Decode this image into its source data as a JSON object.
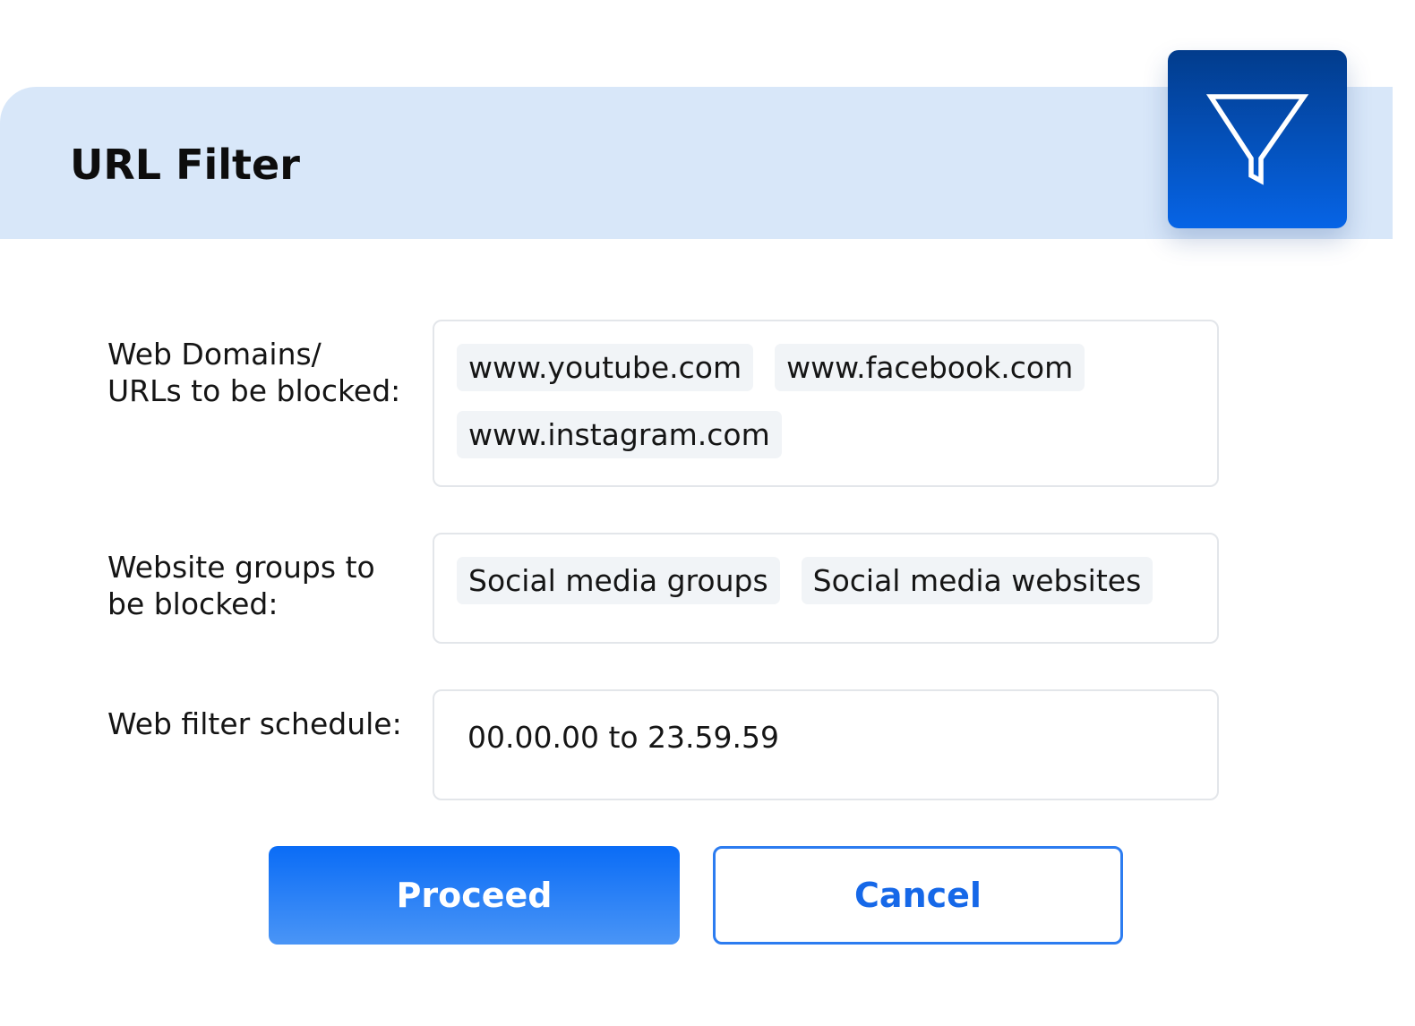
{
  "header": {
    "title": "URL Filter",
    "icon": "filter-funnel-icon",
    "accent_color": "#0664e6",
    "background_color": "#d8e7f9"
  },
  "form": {
    "domains": {
      "label_line1": "Web Domains/",
      "label_line2": "URLs to be blocked:",
      "items": [
        "www.youtube.com",
        "www.facebook.com",
        "www.instagram.com"
      ]
    },
    "groups": {
      "label_line1": "Website groups to",
      "label_line2": "be blocked:",
      "items": [
        "Social media groups",
        "Social media websites"
      ]
    },
    "schedule": {
      "label": "Web filter schedule:",
      "value": "00.00.00 to 23.59.59"
    }
  },
  "actions": {
    "proceed_label": "Proceed",
    "cancel_label": "Cancel",
    "primary_color": "#0a6cf6"
  }
}
